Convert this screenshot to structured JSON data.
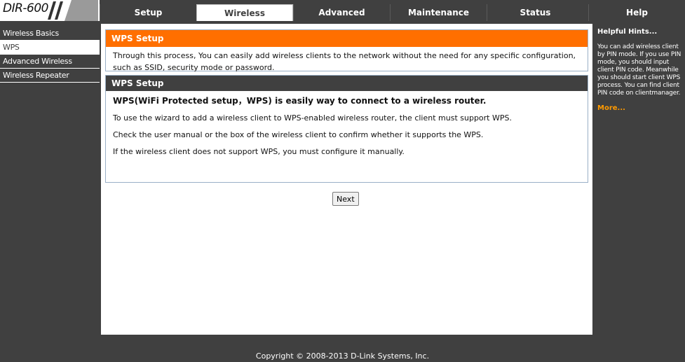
{
  "logo": {
    "text": "DIR-600"
  },
  "tabs": [
    {
      "label": "Setup"
    },
    {
      "label": "Wireless"
    },
    {
      "label": "Advanced"
    },
    {
      "label": "Maintenance"
    },
    {
      "label": "Status"
    },
    {
      "label": "Help"
    }
  ],
  "active_tab": "Wireless",
  "sidebar": {
    "items": [
      {
        "label": "Wireless Basics"
      },
      {
        "label": "WPS"
      },
      {
        "label": "Advanced Wireless"
      },
      {
        "label": "Wireless Repeater"
      }
    ],
    "active_item": "WPS"
  },
  "intro_panel": {
    "title": "WPS Setup",
    "text": "Through this process, You can easily add wireless clients to the network without the need for any specific configuration, such as SSID, security mode or password."
  },
  "wps_panel": {
    "title": "WPS Setup",
    "heading": "WPS(WiFi Protected setup，WPS) is easily way to connect to a wireless router.",
    "lines": [
      "To use the wizard to add a wireless client to WPS-enabled wireless router, the client must support WPS.",
      "Check the user manual or the box of the wireless client to confirm whether it supports the WPS.",
      "If the wireless client does not support WPS, you must configure it manually."
    ]
  },
  "next_button": {
    "label": "Next"
  },
  "hints": {
    "title": "Helpful Hints...",
    "text": "You can add wireless client by PIN mode. If you use PIN mode, you should input client PIN code. Meanwhile you should start client WPS process. You can find client PIN code on clientmanager.",
    "more": "More..."
  },
  "footer": {
    "copyright": "Copyright © 2008-2013 D-Link Systems, Inc."
  },
  "colors": {
    "orange": "#ff6f00",
    "dark": "#404040",
    "more_link": "#ff9a00"
  }
}
